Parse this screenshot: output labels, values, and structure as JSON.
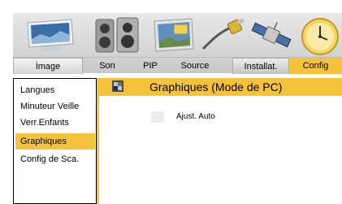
{
  "topmenu": {
    "tabs": [
      {
        "label": "İmage"
      },
      {
        "label": "Son"
      },
      {
        "label": "PIP"
      },
      {
        "label": "Source"
      },
      {
        "label": "Installat."
      },
      {
        "label": "Config"
      }
    ],
    "icons": [
      "monitor-icon",
      "speakers-icon",
      "pip-icon",
      "source-cable-icon",
      "satellite-icon",
      "clock-icon"
    ],
    "active_color": "#f5c33b"
  },
  "sidebar": {
    "items": [
      {
        "label": "Langues"
      },
      {
        "label": "Minuteur Veille"
      },
      {
        "label": "Verr.Enfants"
      },
      {
        "label": "Graphiques"
      },
      {
        "label": "Config de Sca."
      }
    ],
    "active_index": 3
  },
  "main": {
    "title": "Graphiques (Mode de PC)",
    "options": [
      {
        "label": "Ajust. Auto"
      }
    ]
  }
}
